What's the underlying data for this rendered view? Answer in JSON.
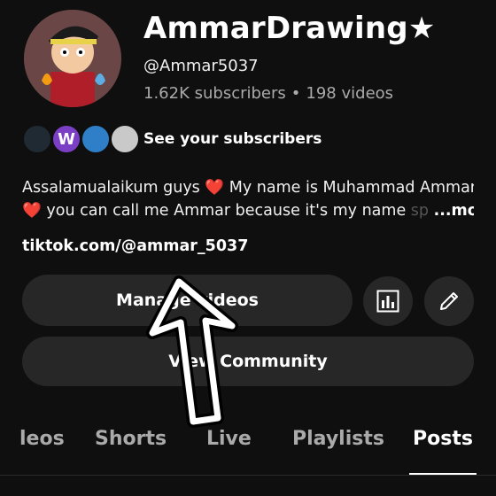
{
  "channel": {
    "name": "AmmarDrawing★",
    "handle": "@Ammar5037",
    "subscribers": "1.62K subscribers",
    "separator": "•",
    "videos": "198 videos"
  },
  "subscribers_row": {
    "avatar_letter": "W",
    "link_text": "See your subscribers"
  },
  "description": {
    "line1_text": "Assalamualaikum guys",
    "line1_tail": "My name is Muhammad Ammar",
    "line2_text": "you can call me Ammar because it's my name",
    "line2_fade": "sp",
    "more": "...more",
    "heart": "❤️"
  },
  "link": "tiktok.com/@ammar_5037",
  "buttons": {
    "manage": "Manage videos",
    "community": "View Community"
  },
  "tabs": [
    {
      "label": "leos"
    },
    {
      "label": "Shorts"
    },
    {
      "label": "Live"
    },
    {
      "label": "Playlists"
    },
    {
      "label": "Posts"
    }
  ],
  "colors": {
    "background": "#0f0f0f",
    "button": "#272727",
    "heart": "#e53935"
  }
}
